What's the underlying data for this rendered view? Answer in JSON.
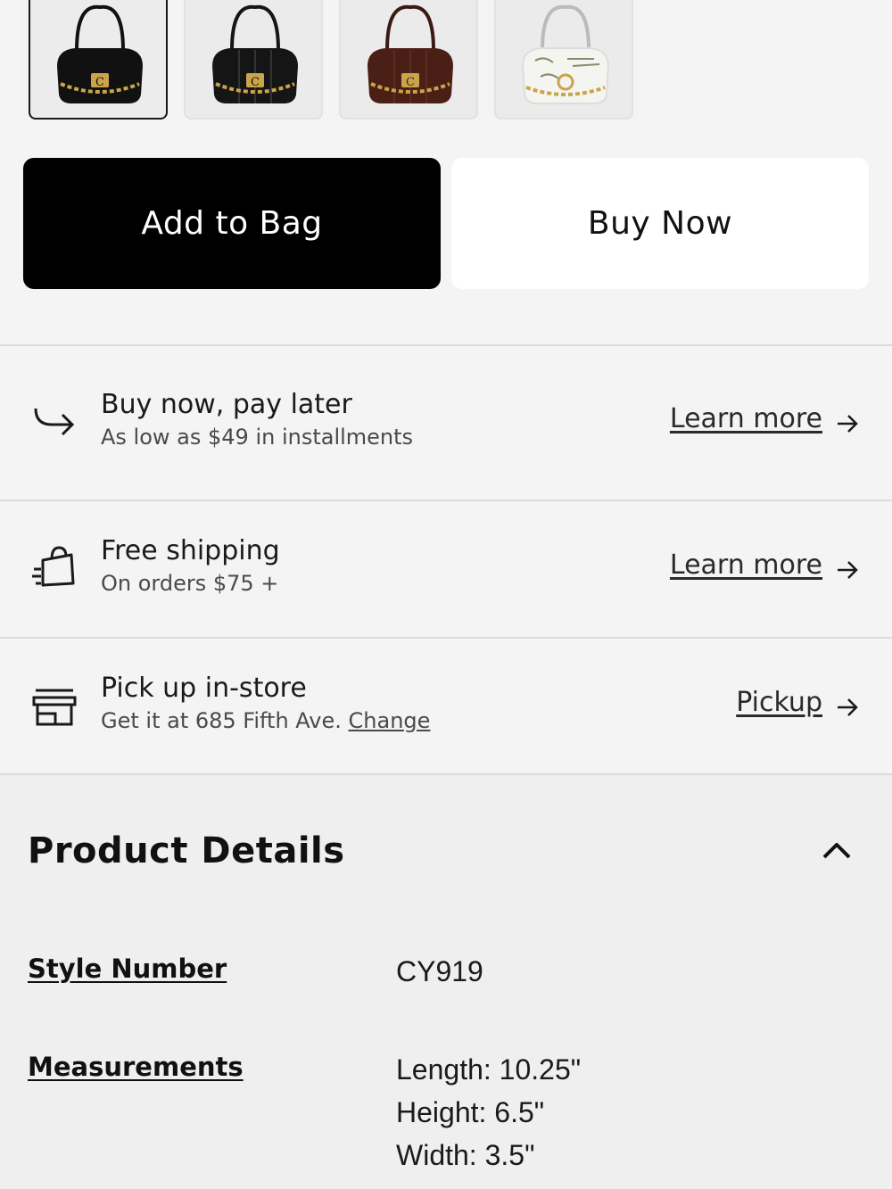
{
  "color_swatches": [
    {
      "color_name": "black",
      "hex": "#111111",
      "selected": true
    },
    {
      "color_name": "black",
      "hex": "#151515",
      "selected": false
    },
    {
      "color_name": "brown",
      "hex": "#4a1f16",
      "selected": false
    },
    {
      "color_name": "white-graffiti",
      "hex": "#f2f2ee",
      "selected": false
    }
  ],
  "actions": {
    "add_to_bag": "Add to Bag",
    "buy_now": "Buy Now"
  },
  "info_rows": {
    "pay_later": {
      "icon": "arrow-turn-right-icon",
      "title": "Buy now, pay later",
      "subtitle": "As low as $49 in installments",
      "link": "Learn more"
    },
    "shipping": {
      "icon": "shopping-bag-fast-icon",
      "title": "Free shipping",
      "subtitle": "On orders $75 +",
      "link": "Learn more"
    },
    "pickup": {
      "icon": "store-icon",
      "title": "Pick up in-store",
      "subtitle_prefix": "Get it at 685 Fifth Ave.",
      "subtitle_link": "Change",
      "link": "Pickup"
    }
  },
  "product_details": {
    "title": "Product Details",
    "expanded": true,
    "style_number_label": "Style Number",
    "style_number": "CY919",
    "measurements_label": "Measurements",
    "length": "Length: 10.25\"",
    "height": "Height: 6.5\"",
    "width": "Width: 3.5\""
  }
}
